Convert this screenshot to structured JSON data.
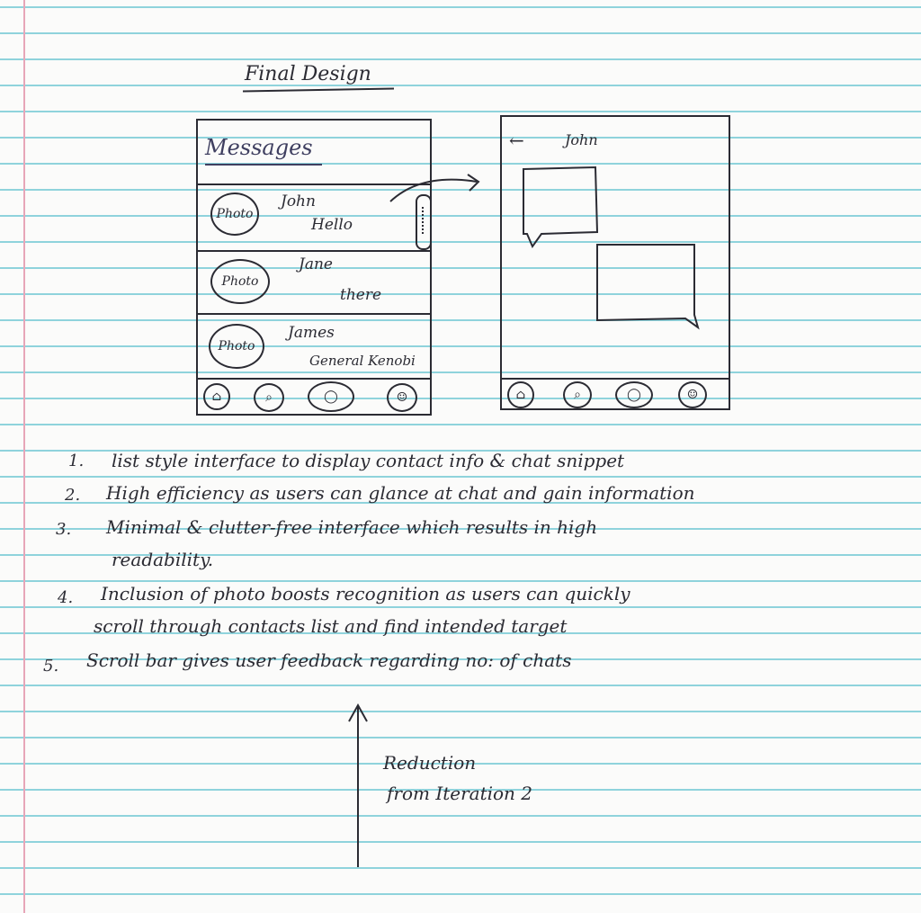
{
  "page": {
    "title": "Final Design"
  },
  "phone_list": {
    "header": "Messages",
    "avatar_label": "Photo",
    "contacts": [
      {
        "name": "John",
        "snippet": "Hello"
      },
      {
        "name": "Jane",
        "snippet": "there"
      },
      {
        "name": "James",
        "snippet": "General Kenobi"
      }
    ]
  },
  "phone_chat": {
    "contact": "John"
  },
  "notes": [
    {
      "num": "1.",
      "text": "list style interface to display contact info & chat snippet"
    },
    {
      "num": "2.",
      "text": "High efficiency as users can glance at chat and gain information"
    },
    {
      "num": "3.",
      "text": "Minimal & clutter-free interface which results in high"
    },
    {
      "num": "",
      "text": "readability."
    },
    {
      "num": "4.",
      "text": "Inclusion of photo boosts recognition as users can quickly"
    },
    {
      "num": "",
      "text": "scroll through contacts list and find intended target"
    },
    {
      "num": "5.",
      "text": "Scroll bar gives user feedback regarding no: of chats"
    }
  ],
  "annotation": {
    "line1": "Reduction",
    "line2": "from Iteration 2"
  },
  "icons": {
    "tabs": [
      "home-icon",
      "search-icon",
      "chat-icon",
      "profile-icon"
    ],
    "back": "back-arrow-icon",
    "transition": "transition-arrow-icon"
  }
}
